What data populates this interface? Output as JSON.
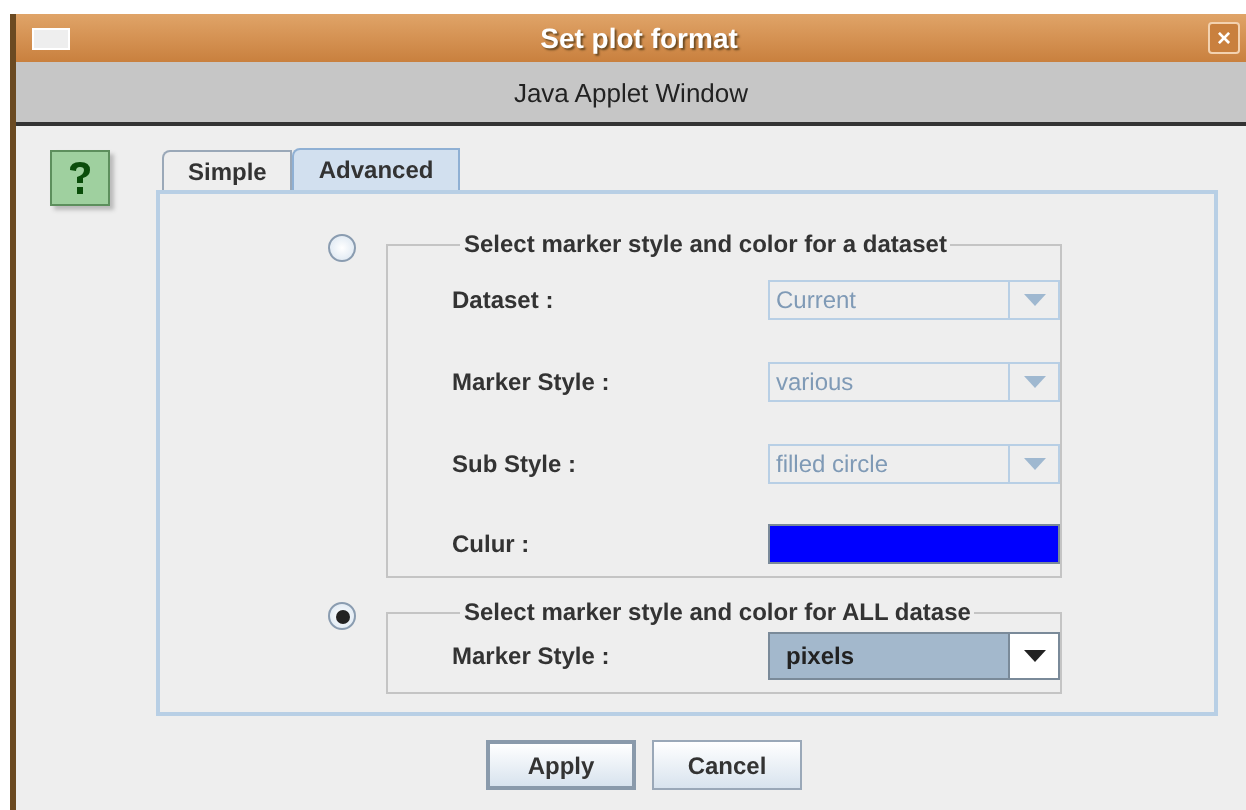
{
  "window": {
    "title": "Set plot format",
    "banner": "Java Applet Window",
    "close_glyph": "×"
  },
  "tabs": [
    {
      "label": "Simple",
      "selected": false
    },
    {
      "label": "Advanced",
      "selected": true
    }
  ],
  "groups": [
    {
      "title": "Select marker style and color for a dataset",
      "selected": false,
      "fields": [
        {
          "kind": "combo",
          "label": "Dataset :",
          "value": "Current",
          "disabled": true
        },
        {
          "kind": "combo",
          "label": "Marker Style :",
          "value": "various",
          "disabled": true
        },
        {
          "kind": "combo",
          "label": "Sub Style :",
          "value": "filled circle",
          "disabled": true
        },
        {
          "kind": "color",
          "label": "Culur :",
          "color": "#0000ff"
        }
      ]
    },
    {
      "title": "Select marker style and color for ALL datase",
      "selected": true,
      "fields": [
        {
          "kind": "combo",
          "label": "Marker Style :",
          "value": "pixels",
          "disabled": false
        }
      ]
    }
  ],
  "buttons": [
    {
      "label": "Apply",
      "default": true
    },
    {
      "label": "Cancel",
      "default": false
    }
  ]
}
